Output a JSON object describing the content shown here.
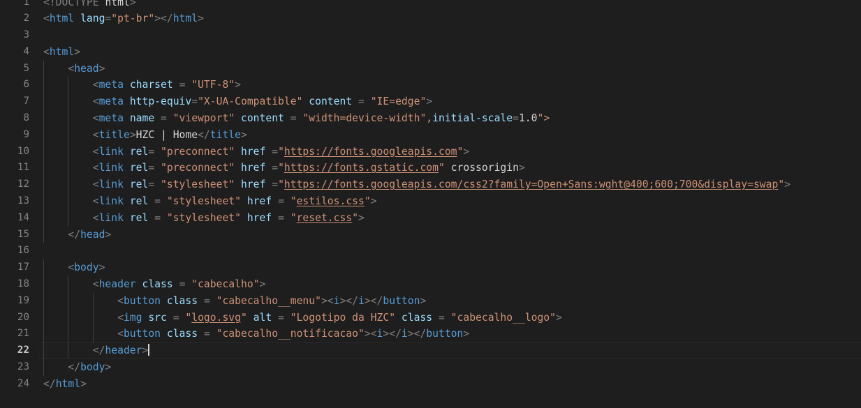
{
  "editor": {
    "app": "code-editor",
    "language": "html",
    "theme": "Dark+",
    "background_color": "#1e1e1e",
    "active_line": 22,
    "total_lines": 24,
    "colors": {
      "tag": "#569cd6",
      "attribute": "#9cdcfe",
      "string": "#ce9178",
      "text": "#d4d4d4",
      "punctuation": "#808080",
      "line_number": "#858585",
      "line_number_active": "#c6c6c6",
      "indent_guide": "#404040"
    }
  },
  "lines": [
    {
      "n": "1",
      "indent": 0,
      "text": "<!DOCTYPE html>"
    },
    {
      "n": "2",
      "indent": 0,
      "text": "<html lang=\"pt-br\"></html>"
    },
    {
      "n": "3",
      "indent": 0,
      "text": ""
    },
    {
      "n": "4",
      "indent": 0,
      "text": "<html>"
    },
    {
      "n": "5",
      "indent": 1,
      "text": "<head>"
    },
    {
      "n": "6",
      "indent": 2,
      "text": "<meta charset = \"UTF-8\">"
    },
    {
      "n": "7",
      "indent": 2,
      "text": "<meta http-equiv=\"X-UA-Compatible\" content = \"IE=edge\">"
    },
    {
      "n": "8",
      "indent": 2,
      "text": "<meta name = \"viewport\" content = \"width=device-width\",initial-scale=1.0\">"
    },
    {
      "n": "9",
      "indent": 2,
      "text": "<title>HZC | Home</title>"
    },
    {
      "n": "10",
      "indent": 2,
      "text": "<link rel= \"preconnect\" href =\"https://fonts.googleapis.com\">"
    },
    {
      "n": "11",
      "indent": 2,
      "text": "<link rel= \"preconnect\" href =\"https://fonts.gstatic.com\" crossorigin>"
    },
    {
      "n": "12",
      "indent": 2,
      "text": "<link rel= \"stylesheet\" href =\"https://fonts.googleapis.com/css2?family=Open+Sans:wght@400;600;700&display=swap\">"
    },
    {
      "n": "13",
      "indent": 2,
      "text": "<link rel = \"stylesheet\" href = \"estilos.css\">"
    },
    {
      "n": "14",
      "indent": 2,
      "text": "<link rel = \"stylesheet\" href = \"reset.css\">"
    },
    {
      "n": "15",
      "indent": 1,
      "text": "</head>"
    },
    {
      "n": "16",
      "indent": 0,
      "text": ""
    },
    {
      "n": "17",
      "indent": 1,
      "text": "<body>"
    },
    {
      "n": "18",
      "indent": 2,
      "text": "<header class = \"cabecalho\">"
    },
    {
      "n": "19",
      "indent": 3,
      "text": "<button class = \"cabecalho__menu\"><i></i></button>"
    },
    {
      "n": "20",
      "indent": 3,
      "text": "<img src = \"logo.svg\" alt = \"Logotipo da HZC\" class = \"cabecalho__logo\">"
    },
    {
      "n": "21",
      "indent": 3,
      "text": "<button class = \"cabecalho__notificacao\"><i></i></button>"
    },
    {
      "n": "22",
      "indent": 2,
      "text": "</header>"
    },
    {
      "n": "23",
      "indent": 1,
      "text": "</body>"
    },
    {
      "n": "24",
      "indent": 0,
      "text": "</html>"
    }
  ],
  "tokens": {
    "line1": [
      [
        "<!DOCTYPE",
        "doctype"
      ],
      [
        " ",
        "text"
      ],
      [
        "html",
        "tag"
      ],
      [
        ">",
        "punct"
      ]
    ],
    "line2": [
      [
        "<",
        "punct"
      ],
      [
        "html",
        "tag"
      ],
      [
        " ",
        "text"
      ],
      [
        "lang",
        "attr"
      ],
      [
        "=",
        "punct"
      ],
      [
        "\"pt-br\"",
        "str"
      ],
      [
        "><",
        "punct"
      ],
      [
        "/html",
        "tag"
      ],
      [
        ">",
        "punct"
      ]
    ],
    "line4": [
      [
        "<",
        "punct"
      ],
      [
        "html",
        "tag"
      ],
      [
        ">",
        "punct"
      ]
    ],
    "line5": [
      [
        "<",
        "punct"
      ],
      [
        "head",
        "tag"
      ],
      [
        ">",
        "punct"
      ]
    ],
    "line6": [
      [
        "<",
        "punct"
      ],
      [
        "meta",
        "tag"
      ],
      [
        " ",
        "text"
      ],
      [
        "charset",
        "attr"
      ],
      [
        " = ",
        "punct"
      ],
      [
        "\"UTF-8\"",
        "str"
      ],
      [
        ">",
        "punct"
      ]
    ],
    "line9": [
      [
        "<",
        "punct"
      ],
      [
        "title",
        "tag"
      ],
      [
        ">",
        "punct"
      ],
      [
        "HZC | Home",
        "text"
      ],
      [
        "</",
        "punct"
      ],
      [
        "title",
        "tag"
      ],
      [
        ">",
        "punct"
      ]
    ],
    "line15": [
      [
        "</",
        "punct"
      ],
      [
        "head",
        "tag"
      ],
      [
        ">",
        "punct"
      ]
    ],
    "line17": [
      [
        "<",
        "punct"
      ],
      [
        "body",
        "tag"
      ],
      [
        ">",
        "punct"
      ]
    ],
    "line22": [
      [
        "</",
        "punct"
      ],
      [
        "header",
        "tag"
      ],
      [
        ">",
        "punct"
      ]
    ],
    "line23": [
      [
        "</",
        "punct"
      ],
      [
        "body",
        "tag"
      ],
      [
        ">",
        "punct"
      ]
    ],
    "line24": [
      [
        "</",
        "punct"
      ],
      [
        "html",
        "tag"
      ],
      [
        ">",
        "punct"
      ]
    ]
  },
  "caret": {
    "line": 22,
    "after_text": "</header>",
    "visible": true
  }
}
